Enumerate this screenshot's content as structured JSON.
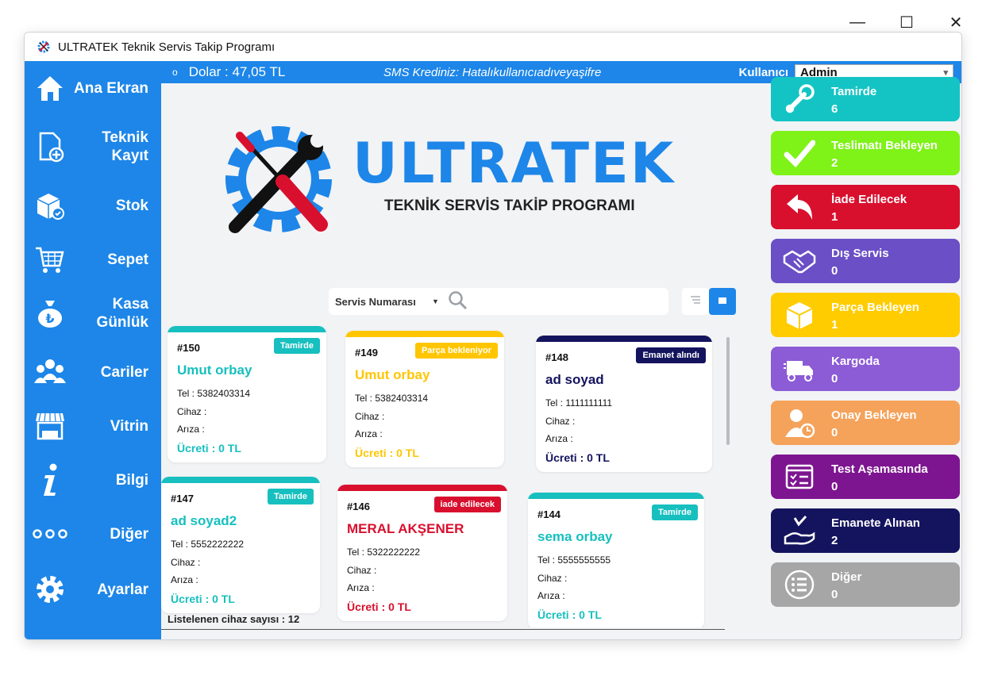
{
  "window": {
    "title": "ULTRATEK Teknik Servis Takip Programı",
    "controls": {
      "minimize": "—",
      "maximize": "☐",
      "close": "✕"
    }
  },
  "topbar": {
    "dot": "o",
    "dolar": "Dolar : 47,05 TL",
    "sms": "SMS Krediniz: Hatalıkullanıcıadıveyaşifre",
    "user_label": "Kullanıcı",
    "user_value": "Admin"
  },
  "sidebar": {
    "items": [
      {
        "label": "Ana Ekran",
        "icon": "home-icon"
      },
      {
        "label": "Teknik\nKayıt",
        "icon": "new-document-icon"
      },
      {
        "label": "Stok",
        "icon": "box-icon"
      },
      {
        "label": "Sepet",
        "icon": "cart-icon"
      },
      {
        "label": "Kasa\nGünlük",
        "icon": "money-bag-icon"
      },
      {
        "label": "Cariler",
        "icon": "people-icon"
      },
      {
        "label": "Vitrin",
        "icon": "store-icon"
      },
      {
        "label": "Bilgi",
        "icon": "info-icon"
      },
      {
        "label": "Diğer",
        "icon": "more-icon"
      },
      {
        "label": "Ayarlar",
        "icon": "gear-icon"
      }
    ]
  },
  "logo": {
    "brand": "ULTRATEK",
    "subtitle": "TEKNİK SERVİS TAKİP PROGRAMI"
  },
  "search": {
    "field": "Servis Numarası"
  },
  "cards": [
    {
      "num": "#150",
      "badge": "Tamirde",
      "name": "Umut orbay",
      "tel": "Tel : 5382403314",
      "cihaz": "Cihaz :",
      "ariza": "Arıza :",
      "ucret": "Ücreti : 0 TL",
      "color": "#17bfbf"
    },
    {
      "num": "#149",
      "badge": "Parça bekleniyor",
      "name": "Umut orbay",
      "tel": "Tel : 5382403314",
      "cihaz": "Cihaz :",
      "ariza": "Arıza :",
      "ucret": "Ücreti : 0 TL",
      "color": "#ffc600"
    },
    {
      "num": "#148",
      "badge": "Emanet alındı",
      "name": "ad soyad",
      "tel": "Tel : 1111111111",
      "cihaz": "Cihaz :",
      "ariza": "Arıza :",
      "ucret": "Ücreti : 0 TL",
      "color": "#14145e"
    },
    {
      "num": "#147",
      "badge": "Tamirde",
      "name": "ad soyad2",
      "tel": "Tel : 5552222222",
      "cihaz": "Cihaz :",
      "ariza": "Arıza :",
      "ucret": "Ücreti : 0 TL",
      "color": "#17bfbf"
    },
    {
      "num": "#146",
      "badge": "iade edilecek",
      "name": "MERAL AKŞENER",
      "tel": "Tel : 5322222222",
      "cihaz": "Cihaz :",
      "ariza": "Arıza :",
      "ucret": "Ücreti : 0 TL",
      "color": "#d8102e"
    },
    {
      "num": "#144",
      "badge": "Tamirde",
      "name": "sema orbay",
      "tel": "Tel : 5555555555",
      "cihaz": "Cihaz :",
      "ariza": "Arıza :",
      "ucret": "Ücreti : 0 TL",
      "color": "#17bfbf"
    }
  ],
  "footer": {
    "count_text": "Listelenen cihaz sayısı : 12"
  },
  "statuses": [
    {
      "title": "Tamirde",
      "count": "6",
      "color": "#14c4c4",
      "icon": "wrench-icon"
    },
    {
      "title": "Teslimatı Bekleyen",
      "count": "2",
      "color": "#7ff218",
      "icon": "checkmark-icon"
    },
    {
      "title": "İade Edilecek",
      "count": "1",
      "color": "#d8102e",
      "icon": "return-arrow-icon"
    },
    {
      "title": "Dış Servis",
      "count": "0",
      "color": "#6a4fc6",
      "icon": "handshake-icon"
    },
    {
      "title": "Parça Bekleyen",
      "count": "1",
      "color": "#ffcc00",
      "icon": "package-icon"
    },
    {
      "title": "Kargoda",
      "count": "0",
      "color": "#8c5bd6",
      "icon": "truck-icon"
    },
    {
      "title": "Onay Bekleyen",
      "count": "0",
      "color": "#f5a25a",
      "icon": "user-clock-icon"
    },
    {
      "title": "Test Aşamasında",
      "count": "0",
      "color": "#7d1590",
      "icon": "checklist-icon"
    },
    {
      "title": "Emanete Alınan",
      "count": "2",
      "color": "#14145e",
      "icon": "hand-check-icon"
    },
    {
      "title": "Diğer",
      "count": "0",
      "color": "#a6a6a6",
      "icon": "list-icon"
    }
  ],
  "colors": {
    "accent": "#1d86e8",
    "background": "#f2f3f5"
  }
}
